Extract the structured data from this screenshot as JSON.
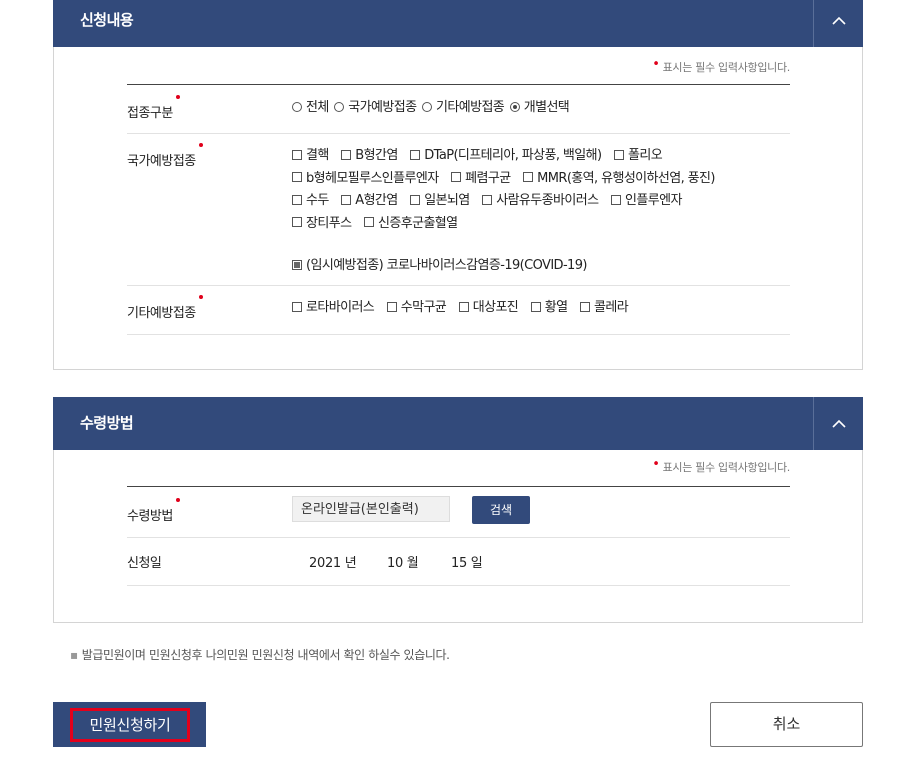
{
  "section1": {
    "title": "신청내용",
    "required_note": "표시는 필수 입력사항입니다.",
    "rows": {
      "type": {
        "label": "접종구분",
        "options": [
          "전체",
          "국가예방접종",
          "기타예방접종",
          "개별선택"
        ],
        "selected": "개별선택"
      },
      "national": {
        "label": "국가예방접종",
        "lines": [
          [
            "결핵",
            "B형간염",
            "DTaP(디프테리아, 파상풍, 백일해)",
            "폴리오"
          ],
          [
            "b형헤모필루스인플루엔자",
            "폐렴구균",
            "MMR(홍역, 유행성이하선염, 풍진)"
          ],
          [
            "수두",
            "A형간염",
            "일본뇌염",
            "사람유두종바이러스",
            "인플루엔자"
          ],
          [
            "장티푸스",
            "신증후군출혈열"
          ]
        ],
        "covid": "(임시예방접종) 코로나바이러스감염증-19(COVID-19)",
        "covid_checked": true
      },
      "other": {
        "label": "기타예방접종",
        "options": [
          "로타바이러스",
          "수막구균",
          "대상포진",
          "황열",
          "콜레라"
        ]
      }
    }
  },
  "section2": {
    "title": "수령방법",
    "required_note": "표시는 필수 입력사항입니다.",
    "method": {
      "label": "수령방법",
      "value": "온라인발급(본인출력)",
      "search_label": "검색"
    },
    "date": {
      "label": "신청일",
      "year": "2021 년",
      "month": "10 월",
      "day": "15 일"
    }
  },
  "footnote": "발급민원이며 민원신청후 나의민원 민원신청 내역에서 확인 하실수 있습니다.",
  "buttons": {
    "submit": "민원신청하기",
    "cancel": "취소"
  },
  "colors": {
    "header_bg": "#324a7b",
    "required_dot": "#e0001b",
    "highlight": "#e3001b"
  }
}
